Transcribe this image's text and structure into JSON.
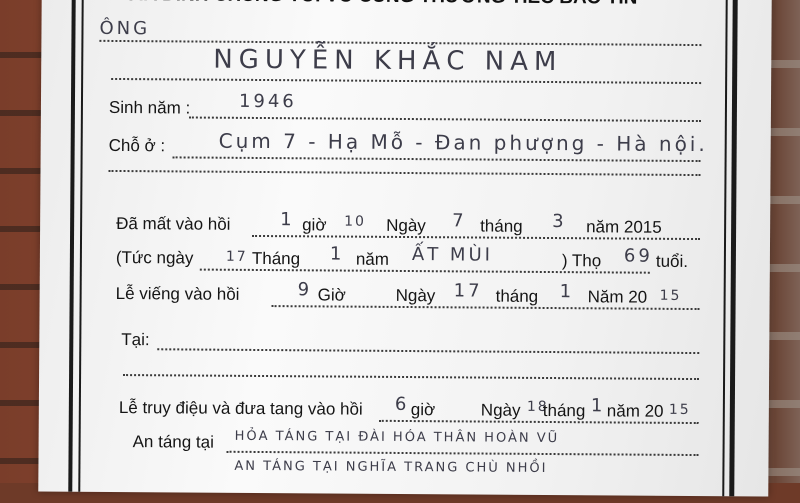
{
  "header": {
    "title": "GIA ĐÌNH CHÚNG TÔI VÔ CÙNG THƯƠNG TIẾC BÁO TIN"
  },
  "deceased": {
    "honorific": "ÔNG",
    "name": "NGUYỄN KHẮC NAM"
  },
  "birth": {
    "label": "Sinh năm :",
    "value": "1946"
  },
  "residence": {
    "label": "Chỗ ở :",
    "value": "Cụm 7 - Hạ Mỗ - Đan phượng - Hà nội."
  },
  "death": {
    "prefix": "Đã mất vào hồi",
    "hour": "1",
    "hour_label": "giờ",
    "minute": "10",
    "day_label": "Ngày",
    "day": "7",
    "month_label": "tháng",
    "month": "3",
    "year_label": "năm 2015"
  },
  "lunar": {
    "prefix": "(Tức ngày",
    "day": "17",
    "month_label": "Tháng",
    "month": "1",
    "year_label": "năm",
    "year": "ẤT MÙI",
    "age_label": ") Thọ",
    "age": "69",
    "age_suffix": "tuổi."
  },
  "visitation": {
    "prefix": "Lễ viếng  vào hồi",
    "hour": "9",
    "hour_label": "Giờ",
    "day_label": "Ngày",
    "day": "17",
    "month_label": "tháng",
    "month": "1",
    "year_label": "Năm 20",
    "year_suffix": "15"
  },
  "location": {
    "label": "Tại:"
  },
  "memorial": {
    "prefix": "Lễ truy điệu và đưa tang vào hồi",
    "hour": "6",
    "hour_label": "giờ",
    "day_label": "Ngày",
    "day": "18",
    "month_label": "tháng",
    "month": "1",
    "year_label": "năm 20",
    "year_suffix": "15"
  },
  "burial": {
    "label": "An táng tại",
    "value": "HỎA TÁNG TẠI ĐÀI HÓA THÂN HOÀN VŨ",
    "value2": "AN TÁNG TẠI NGHĨA TRANG CHÙ NHỒI"
  }
}
